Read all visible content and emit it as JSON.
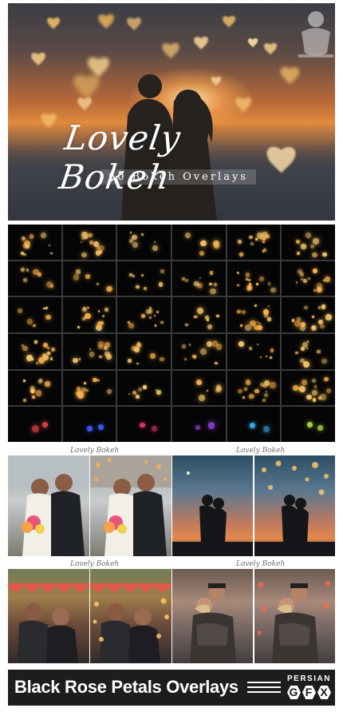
{
  "hero": {
    "title": "Lovely Bokeh",
    "subtitle": "60 Bokeh Overlays"
  },
  "panels": {
    "label": "Lovely Bokeh"
  },
  "footer": {
    "title": "Black Rose Petals Overlays",
    "brand_top": "PERSIAN",
    "brand_letters": [
      "G",
      "F",
      "X"
    ]
  },
  "colors": {
    "bokeh_warm": "#ffb24a",
    "bokeh_gold": "#f7c66a",
    "footer_bg": "#1d1d1f",
    "grid_bg": "#050505"
  },
  "icons": [
    "heart-icon",
    "watermark-logo-icon",
    "divider-lines-icon"
  ]
}
